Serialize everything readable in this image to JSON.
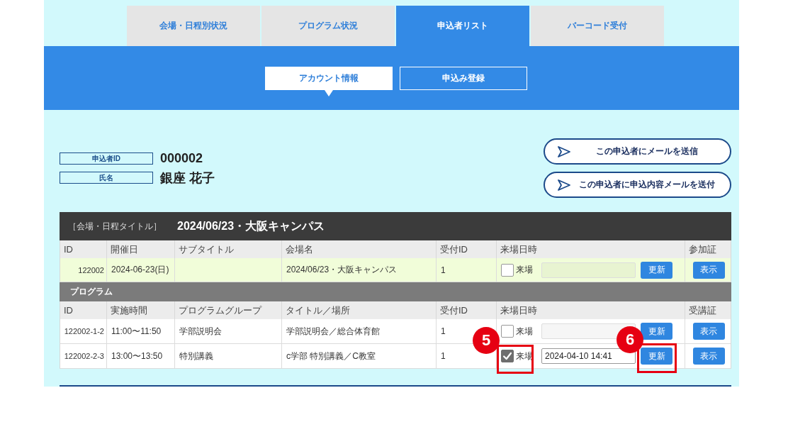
{
  "tabs": [
    {
      "label": "会場・日程別状況",
      "selected": false
    },
    {
      "label": "プログラム状況",
      "selected": false
    },
    {
      "label": "申込者リスト",
      "selected": true
    },
    {
      "label": "バーコード受付",
      "selected": false
    }
  ],
  "subtabs": [
    {
      "label": "アカウント情報",
      "selected": true
    },
    {
      "label": "申込み登録",
      "selected": false
    }
  ],
  "applicant": [
    {
      "label": "申込者ID",
      "value": "000002"
    },
    {
      "label": "氏名",
      "value": "銀座 花子"
    }
  ],
  "actions": [
    "この申込者にメールを送信",
    "この申込者に申込内容メールを送付"
  ],
  "venue_table": {
    "title_label": "［会場・日程タイトル］",
    "title": "2024/06/23・大阪キャンパス",
    "columns": [
      "ID",
      "開催日",
      "サブタイトル",
      "会場名",
      "受付ID",
      "来場日時",
      "参加証"
    ],
    "rows": [
      {
        "id": "122002",
        "date": "2024-06-23(日)",
        "venue": "2024/06/23・大阪キャンパス",
        "reception_id": "1",
        "attended": false,
        "attend_label": "来場",
        "date_field": {
          "disabled": true
        },
        "update_button": "更新",
        "view_button": "表示"
      }
    ]
  },
  "program_section": {
    "title": "プログラム",
    "columns": [
      "ID",
      "実施時間",
      "プログラムグループ",
      "タイトル／場所",
      "受付ID",
      "来場日時",
      "受講証"
    ],
    "rows": [
      {
        "id": "122002-1-2",
        "time": "11:00〜11:50",
        "group": "学部説明会",
        "title": "学部説明会／総合体育館",
        "reception_id": "1",
        "attended": false,
        "attend_label": "来場",
        "date_field": {
          "disabled": true
        },
        "update_button": "更新",
        "view_button": "表示"
      },
      {
        "id": "122002-2-3",
        "time": "13:00〜13:50",
        "group": "特別講義",
        "title": "c学部 特別講義／C教室",
        "reception_id": "1",
        "attended": true,
        "attend_label": "来場",
        "date_field": {
          "value": "2024-04-10 14:41",
          "disabled": false
        },
        "update_button": "更新",
        "view_button": "表示",
        "checkbox_callout": "5",
        "update_callout": "6"
      }
    ]
  }
}
